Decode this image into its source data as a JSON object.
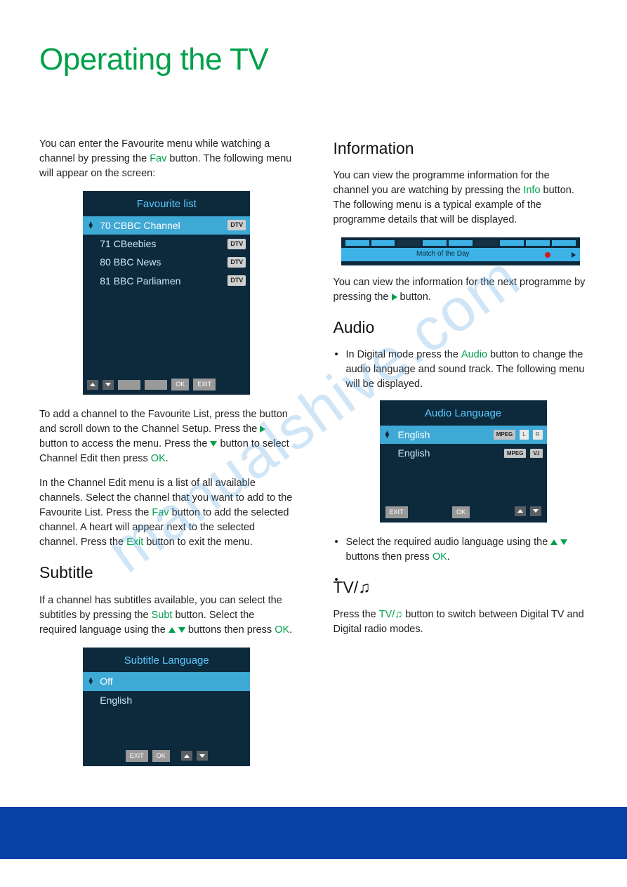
{
  "title": "Operating the TV",
  "watermark": "manualshive.com",
  "left": {
    "intro_a": "You can enter the Favourite menu while watching a channel by pressing the ",
    "intro_b": "Fav",
    "intro_c": " button. The following menu will appear on the screen:",
    "fav_osd": {
      "title": "Favourite list",
      "items": [
        {
          "num": "70",
          "name": "CBBC Channel",
          "badge": "DTV",
          "sel": true
        },
        {
          "num": "71",
          "name": "CBeebies",
          "badge": "DTV",
          "sel": false
        },
        {
          "num": "80",
          "name": "BBC News",
          "badge": "DTV",
          "sel": false
        },
        {
          "num": "81",
          "name": "BBC Parliamen",
          "badge": "DTV",
          "sel": false
        }
      ],
      "footer_ok": "OK",
      "footer_exit": "EXIT"
    },
    "p2_a": "To add a channel to the Favourite List, press the ",
    "p2_b": " button and scroll down to the Channel Setup. Press the ",
    "p2_c": " button to access the menu. Press the ",
    "p2_d": " button to select Channel Edit then press ",
    "p2_e": "OK",
    "p2_f": ".",
    "p3_a": "In the Channel Edit menu is a list of all available channels. Select the channel that you want to add to the Favourite List. Press the ",
    "p3_b": "Fav",
    "p3_c": " button to add the selected channel. A heart will appear next to the selected channel. Press the ",
    "p3_d": "Exit",
    "p3_e": " button to exit the menu.",
    "subtitle_h": "Subtitle",
    "sub_a": "If a channel has subtitles available, you can select the subtitles by pressing the ",
    "sub_b": "Subt",
    "sub_c": " button. Select the required language using the ",
    "sub_d": " buttons then press ",
    "sub_e": "OK",
    "sub_f": ".",
    "sub_osd": {
      "title": "Subtitle Language",
      "items": [
        {
          "name": "Off",
          "sel": true
        },
        {
          "name": "English",
          "sel": false
        }
      ],
      "exit": "EXIT",
      "ok": "OK"
    }
  },
  "right": {
    "info_h": "Information",
    "info_a": "You can view the programme information for the channel you are watching by pressing the ",
    "info_b": "Info",
    "info_c": " button. The following menu is a typical example of the programme details that will be displayed.",
    "info_osd": {
      "prog": "Match of the Day"
    },
    "info2_a": "You can view the information for the next programme by pressing the ",
    "info2_b": " button.",
    "audio_h": "Audio",
    "aud_a": "In Digital mode press the ",
    "aud_b": "Audio",
    "aud_c": " button to change the audio language and sound track. The following menu will be displayed.",
    "aud_osd": {
      "title": "Audio Language",
      "r1": {
        "lang": "English",
        "c1": "MPEG",
        "c2": "L",
        "c3": "R"
      },
      "r2": {
        "lang": "English",
        "c1": "MPEG",
        "c2": "V.I"
      },
      "exit": "EXIT",
      "ok": "OK"
    },
    "aud2_a": "Select the required audio language using the ",
    "aud2_b": " buttons then press ",
    "aud2_c": "OK",
    "aud2_d": ".",
    "tv_h": "TV/♫",
    "tv_a": "Press the ",
    "tv_b": "TV/♫",
    "tv_c": " button to switch between Digital TV and Digital radio modes."
  }
}
